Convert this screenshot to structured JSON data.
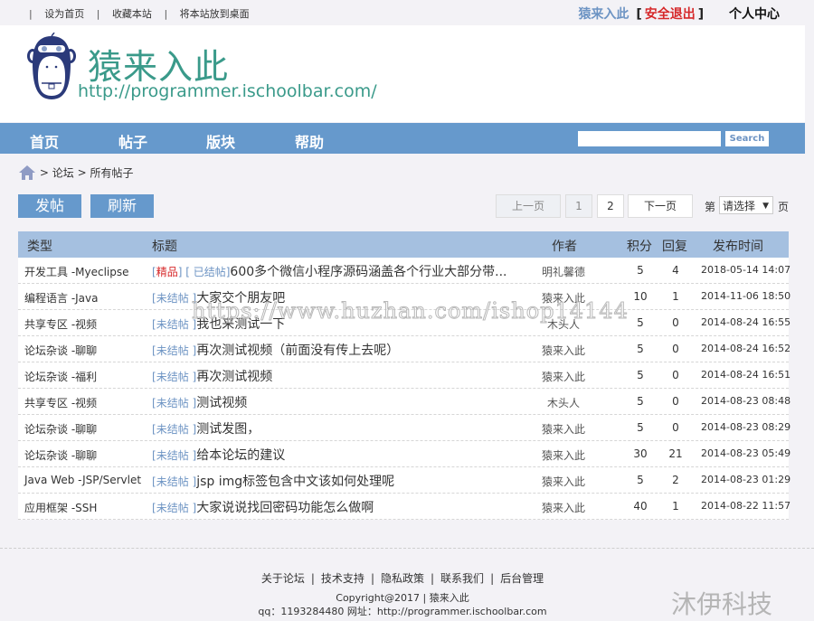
{
  "topbar": {
    "links": [
      "设为首页",
      "收藏本站",
      "将本站放到桌面"
    ],
    "user_name": "猿来入此",
    "logout_label": "安全退出",
    "profile_label": "个人中心"
  },
  "header": {
    "site_name": "猿来入此",
    "site_url": "http://programmer.ischoolbar.com/"
  },
  "nav": {
    "items": [
      "首页",
      "帖子",
      "版块",
      "帮助"
    ],
    "search_value": "",
    "search_button": "Search"
  },
  "breadcrumb": {
    "items": [
      "论坛",
      "所有帖子"
    ]
  },
  "actions": {
    "post_label": "发帖",
    "refresh_label": "刷新"
  },
  "pager": {
    "prev_label": "上一页",
    "pages": [
      "1",
      "2"
    ],
    "current_page": "1",
    "next_label": "下一页",
    "goto_prefix": "第",
    "goto_select": "请选择",
    "goto_suffix": "页"
  },
  "table": {
    "headers": {
      "type": "类型",
      "title": "标题",
      "author": "作者",
      "score": "积分",
      "reply": "回复",
      "time": "发布时间"
    },
    "rows": [
      {
        "type": "开发工具 -Myeclipse",
        "tag_fine": "精品",
        "status": "已结帖",
        "title": "600多个微信小程序源码涵盖各个行业大部分带...",
        "author": "明礼馨德",
        "score": "5",
        "reply": "4",
        "time": "2018-05-14 14:07"
      },
      {
        "type": "编程语言 -Java",
        "tag_fine": "",
        "status": "未结帖 ",
        "title": "大家交个朋友吧",
        "author": "猿来入此",
        "score": "10",
        "reply": "1",
        "time": "2014-11-06 18:50"
      },
      {
        "type": "共享专区 -视频",
        "tag_fine": "",
        "status": "未结帖 ",
        "title": "我也来测试一下",
        "author": "木头人",
        "score": "5",
        "reply": "0",
        "time": "2014-08-24 16:55"
      },
      {
        "type": "论坛杂谈 -聊聊",
        "tag_fine": "",
        "status": "未结帖 ",
        "title": "再次测试视频（前面没有传上去呢）",
        "author": "猿来入此",
        "score": "5",
        "reply": "0",
        "time": "2014-08-24 16:52"
      },
      {
        "type": "论坛杂谈 -福利",
        "tag_fine": "",
        "status": "未结帖 ",
        "title": "再次测试视频",
        "author": "猿来入此",
        "score": "5",
        "reply": "0",
        "time": "2014-08-24 16:51"
      },
      {
        "type": "共享专区 -视频",
        "tag_fine": "",
        "status": "未结帖 ",
        "title": "测试视频",
        "author": "木头人",
        "score": "5",
        "reply": "0",
        "time": "2014-08-23 08:48"
      },
      {
        "type": "论坛杂谈 -聊聊",
        "tag_fine": "",
        "status": "未结帖 ",
        "title": "测试发图，",
        "author": "猿来入此",
        "score": "5",
        "reply": "0",
        "time": "2014-08-23 08:29"
      },
      {
        "type": "论坛杂谈 -聊聊",
        "tag_fine": "",
        "status": "未结帖 ",
        "title": "给本论坛的建议",
        "author": "猿来入此",
        "score": "30",
        "reply": "21",
        "time": "2014-08-23 05:49"
      },
      {
        "type": "Java Web -JSP/Servlet",
        "tag_fine": "",
        "status": "未结帖 ",
        "title": "jsp img标签包含中文该如何处理呢",
        "author": "猿来入此",
        "score": "5",
        "reply": "2",
        "time": "2014-08-23 01:29"
      },
      {
        "type": "应用框架 -SSH",
        "tag_fine": "",
        "status": "未结帖 ",
        "title": "大家说说找回密码功能怎么做啊",
        "author": "猿来入此",
        "score": "40",
        "reply": "1",
        "time": "2014-08-22 11:57"
      }
    ]
  },
  "footer": {
    "links": [
      "关于论坛",
      "技术支持",
      "隐私政策",
      "联系我们",
      "后台管理"
    ],
    "copyright": "Copyright@2017 | 猿来入此",
    "contact": "qq：1193284480 网址：http://programmer.ischoolbar.com"
  },
  "watermarks": {
    "url": "https://www.huzhan.com/ishop14144",
    "brand": "沐伊科技"
  },
  "colors": {
    "accent": "#6699cc",
    "table_header": "#a5c0e0",
    "brand_teal": "#3a9a8a",
    "logout_red": "#d6282a",
    "tag_blue": "#6c93c3"
  }
}
